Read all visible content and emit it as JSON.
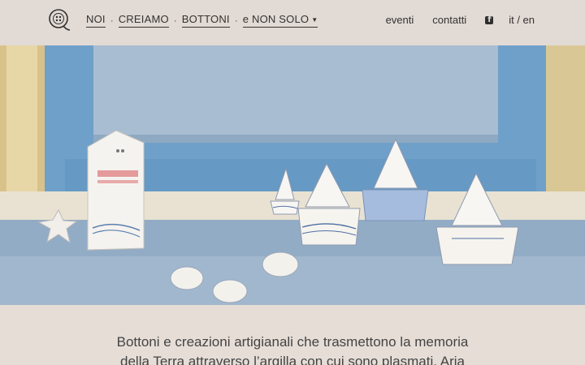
{
  "nav": {
    "items": [
      "NOI",
      "CREIAMO",
      "BOTTONI",
      "e NON SOLO"
    ],
    "separator": "·",
    "right": {
      "eventi": "eventi",
      "contatti": "contatti",
      "lang": "it / en"
    }
  },
  "intro": {
    "line1": "Bottoni e creazioni artigianali che trasmettono la memoria",
    "line2": "della Terra attraverso l’argilla con cui sono plasmati. Aria"
  },
  "colors": {
    "header_bg": "#e2dad4",
    "body_bg": "#e6ddd6",
    "text": "#333333"
  },
  "icons": [
    "logo-icon",
    "chevron-down-icon",
    "facebook-icon"
  ]
}
